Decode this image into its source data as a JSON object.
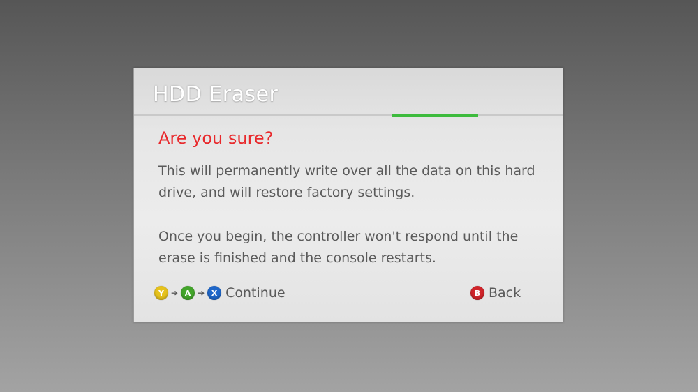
{
  "dialog": {
    "title": "HDD Eraser",
    "subtitle": "Are you sure?",
    "paragraph1": "This will permanently write over all the data on this hard drive, and will restore factory settings.",
    "paragraph2": "Once you begin, the controller won't respond until the erase is finished and the console restarts."
  },
  "footer": {
    "sequence": [
      {
        "glyph": "Y",
        "icon": "y-button-icon",
        "color": "#e6c21c"
      },
      {
        "glyph": "A",
        "icon": "a-button-icon",
        "color": "#43a52b"
      },
      {
        "glyph": "X",
        "icon": "x-button-icon",
        "color": "#1f67c9"
      }
    ],
    "arrow": "➔",
    "continue_label": "Continue",
    "back": {
      "glyph": "B",
      "icon": "b-button-icon",
      "color": "#d0242a"
    },
    "back_label": "Back"
  },
  "colors": {
    "accent_green": "#3dbb3d",
    "warning_red": "#e8292c"
  }
}
